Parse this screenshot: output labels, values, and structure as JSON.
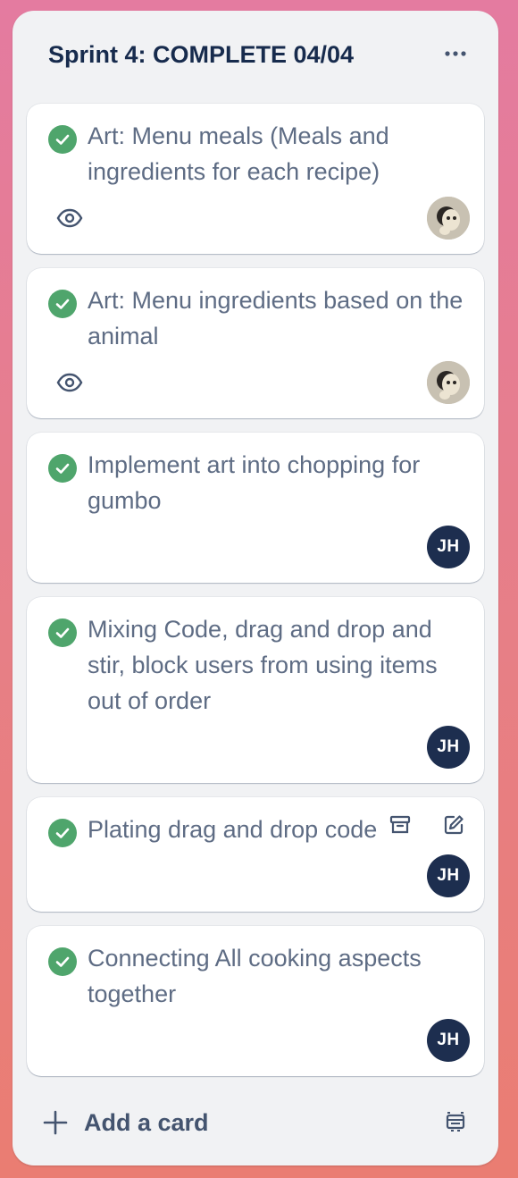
{
  "list": {
    "title": "Sprint 4: COMPLETE 04/04",
    "menu_icon": "ellipsis-icon"
  },
  "cards": [
    {
      "title": "Art: Menu meals (Meals and ingredients for each recipe)",
      "status_icon": "check-circle-icon",
      "has_watch": true,
      "avatar": {
        "type": "photo",
        "initials": ""
      }
    },
    {
      "title": "Art: Menu ingredients based on the animal",
      "status_icon": "check-circle-icon",
      "has_watch": true,
      "avatar": {
        "type": "photo",
        "initials": ""
      }
    },
    {
      "title": "Implement art into chopping for gumbo",
      "status_icon": "check-circle-icon",
      "has_watch": false,
      "avatar": {
        "type": "initials",
        "initials": "JH"
      }
    },
    {
      "title": "Mixing Code, drag and drop and stir, block users from using items out of order",
      "status_icon": "check-circle-icon",
      "has_watch": false,
      "avatar": {
        "type": "initials",
        "initials": "JH"
      }
    },
    {
      "title": "Plating drag and drop code",
      "status_icon": "check-circle-icon",
      "has_watch": false,
      "hover_actions": [
        "archive-icon",
        "edit-icon"
      ],
      "avatar": {
        "type": "initials",
        "initials": "JH"
      }
    },
    {
      "title": "Connecting All cooking aspects together",
      "status_icon": "check-circle-icon",
      "has_watch": false,
      "avatar": {
        "type": "initials",
        "initials": "JH"
      }
    }
  ],
  "footer": {
    "add_card_label": "Add a card",
    "add_icon": "plus-icon",
    "template_icon": "card-template-icon"
  },
  "colors": {
    "check_green": "#4fa56c",
    "avatar_navy": "#1d2e4f",
    "title_navy": "#172b4d",
    "card_text": "#5e6c84"
  }
}
